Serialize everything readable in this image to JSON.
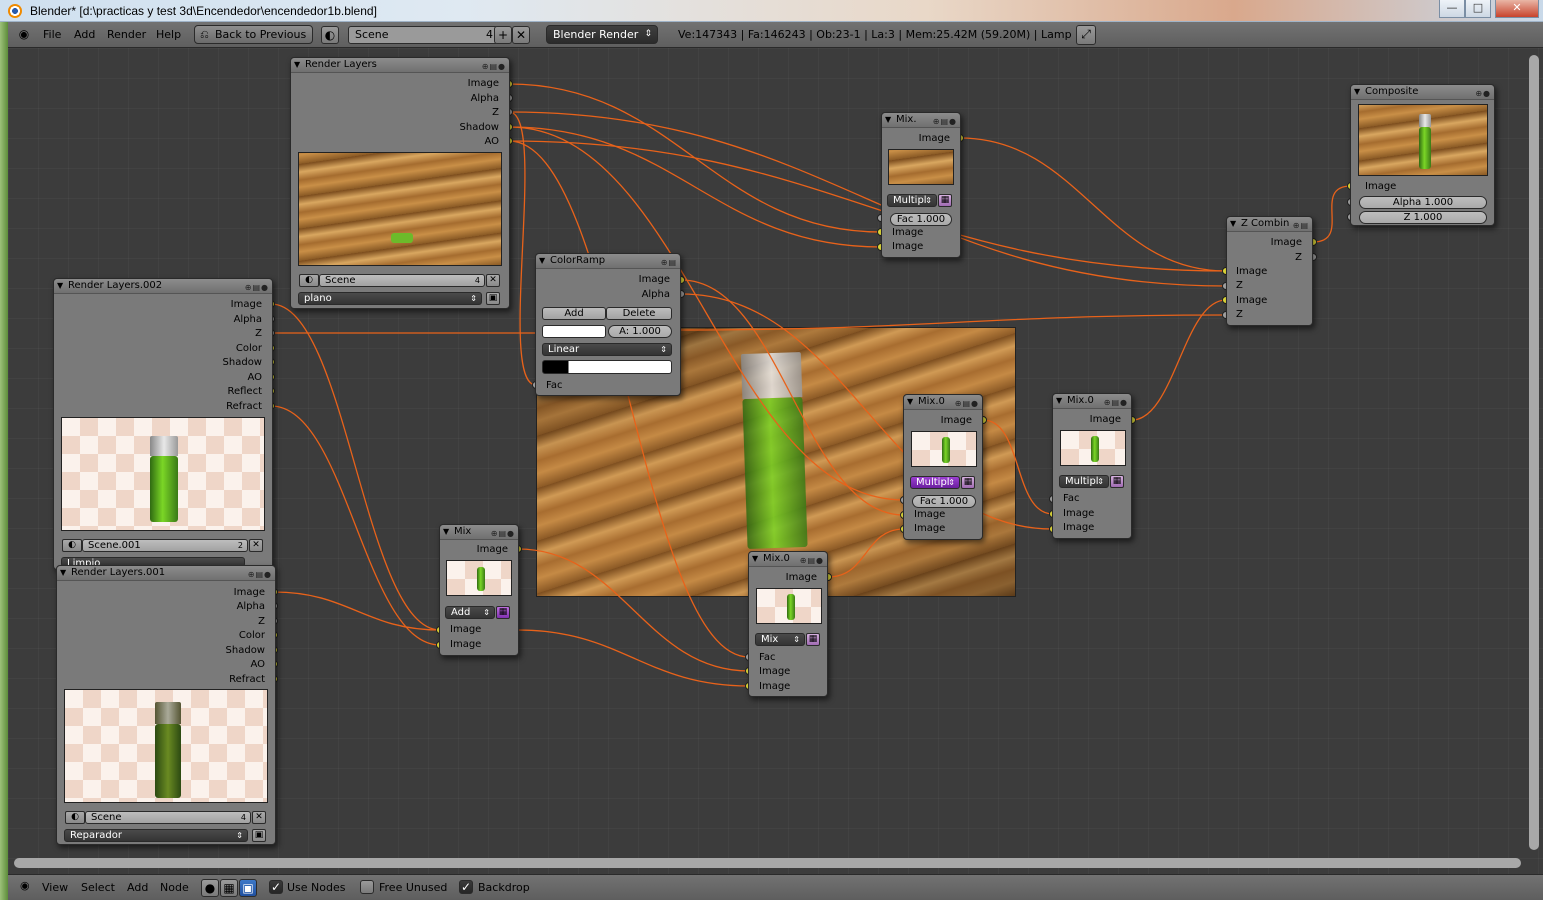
{
  "window": {
    "title": "Blender* [d:\\practicas y test 3d\\Encendedor\\encendedor1b.blend]",
    "minimize": "—",
    "maximize": "□",
    "close": "✕"
  },
  "header": {
    "menus": [
      "File",
      "Add",
      "Render",
      "Help"
    ],
    "back_label": "Back to Previous",
    "scene_name": "Scene",
    "scene_users": "4",
    "add_icon": "+",
    "remove_icon": "✕",
    "engine": "Blender Render",
    "stats": "Ve:147343 | Fa:146243 | Ob:23-1 | La:3 | Mem:25.42M (59.20M) | Lamp"
  },
  "nodes": {
    "render_layers": {
      "title": "Render Layers",
      "outputs": [
        "Image",
        "Alpha",
        "Z",
        "Shadow",
        "AO"
      ],
      "scene": "Scene",
      "scene_users": "4",
      "layer": "plano"
    },
    "render_layers_002": {
      "title": "Render Layers.002",
      "outputs": [
        "Image",
        "Alpha",
        "Z",
        "Color",
        "Shadow",
        "AO",
        "Reflect",
        "Refract"
      ],
      "scene": "Scene.001",
      "scene_users": "2",
      "layer": "Limpio"
    },
    "render_layers_001": {
      "title": "Render Layers.001",
      "outputs": [
        "Image",
        "Alpha",
        "Z",
        "Color",
        "Shadow",
        "AO",
        "Refract"
      ],
      "scene": "Scene",
      "scene_users": "4",
      "layer": "Reparador"
    },
    "colorramp": {
      "title": "ColorRamp",
      "outputs": [
        "Image",
        "Alpha"
      ],
      "add_label": "Add",
      "delete_label": "Delete",
      "alpha": "A: 1.000",
      "interpolation": "Linear",
      "input": "Fac"
    },
    "mix_top": {
      "title": "Mix.",
      "output": "Image",
      "blend": "Multipl",
      "fac": "Fac 1.000",
      "inputs": [
        "Image",
        "Image"
      ]
    },
    "composite": {
      "title": "Composite",
      "input": "Image",
      "alpha": "Alpha 1.000",
      "z": "Z 1.000"
    },
    "zcombine": {
      "title": "Z Combin",
      "outputs": [
        "Image",
        "Z"
      ],
      "inputs": [
        "Image",
        "Z",
        "Image",
        "Z"
      ]
    },
    "mix_add": {
      "title": "Mix",
      "output": "Image",
      "blend": "Add",
      "inputs": [
        "Image",
        "Image"
      ]
    },
    "mix0_center": {
      "title": "Mix.0",
      "output": "Image",
      "blend": "Multipl",
      "fac": "Fac 1.000",
      "inputs": [
        "Image",
        "Image"
      ]
    },
    "mix0_right": {
      "title": "Mix.0",
      "output": "Image",
      "blend": "Multipl",
      "inputs": [
        "Fac",
        "Image",
        "Image"
      ]
    },
    "mix0_bottom": {
      "title": "Mix.0",
      "output": "Image",
      "blend": "Mix",
      "inputs": [
        "Fac",
        "Image",
        "Image"
      ]
    }
  },
  "footer": {
    "menus": [
      "View",
      "Select",
      "Add",
      "Node"
    ],
    "use_nodes": "Use Nodes",
    "free_unused": "Free Unused",
    "backdrop": "Backdrop",
    "use_nodes_checked": true,
    "free_unused_checked": false,
    "backdrop_checked": true
  },
  "colors": {
    "wire": "#e8621a",
    "socket_color": "#e8e23a",
    "socket_value": "#a9a9a9",
    "node_bg": "#7a7a7a",
    "editor_bg": "#3c3c3c"
  }
}
